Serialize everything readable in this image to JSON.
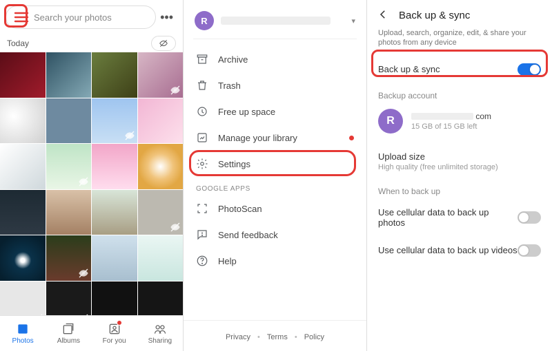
{
  "panel1": {
    "search_placeholder": "Search your photos",
    "section_label": "Today",
    "nav": [
      {
        "label": "Photos",
        "active": true
      },
      {
        "label": "Albums",
        "active": false
      },
      {
        "label": "For you",
        "active": false,
        "badge": true
      },
      {
        "label": "Sharing",
        "active": false
      }
    ]
  },
  "panel2": {
    "avatar_initial": "R",
    "menu": {
      "archive": "Archive",
      "trash": "Trash",
      "free_up": "Free up space",
      "manage_library": "Manage your library",
      "settings": "Settings"
    },
    "section_google_apps": "GOOGLE APPS",
    "menu2": {
      "photoscan": "PhotoScan",
      "send_feedback": "Send feedback",
      "help": "Help"
    },
    "footer": {
      "privacy": "Privacy",
      "terms": "Terms",
      "policy": "Policy"
    }
  },
  "panel3": {
    "title": "Back up & sync",
    "subtitle": "Upload, search, organize, edit, & share your photos from any device",
    "backup_sync_label": "Back up & sync",
    "backup_sync_on": true,
    "backup_account_label": "Backup account",
    "account": {
      "avatar_initial": "R",
      "email_suffix": "com",
      "storage_line": "15 GB of 15 GB left"
    },
    "upload_size": {
      "label": "Upload size",
      "value": "High quality (free unlimited storage)"
    },
    "when_label": "When to back up",
    "cell_photos": {
      "label": "Use cellular data to back up photos",
      "on": false
    },
    "cell_videos": {
      "label": "Use cellular data to back up videos",
      "on": false
    }
  }
}
